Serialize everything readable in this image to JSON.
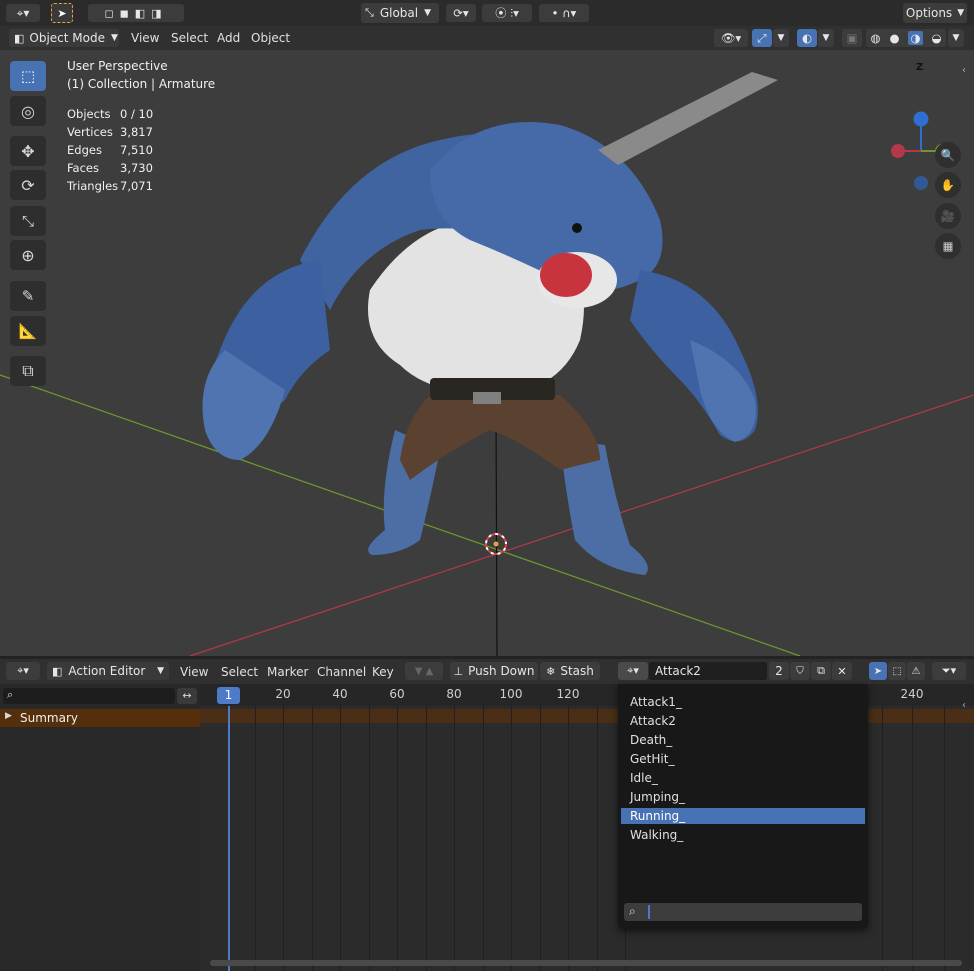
{
  "top_header": {
    "transform_orientation": "Global",
    "options_label": "Options"
  },
  "view_header": {
    "mode": "Object Mode",
    "menus": [
      "View",
      "Select",
      "Add",
      "Object"
    ]
  },
  "viewport": {
    "perspective": "User Perspective",
    "collection": "(1) Collection | Armature",
    "stats": [
      {
        "label": "Objects",
        "value": "0 / 10"
      },
      {
        "label": "Vertices",
        "value": "3,817"
      },
      {
        "label": "Edges",
        "value": "7,510"
      },
      {
        "label": "Faces",
        "value": "3,730"
      },
      {
        "label": "Triangles",
        "value": "7,071"
      }
    ],
    "gizmo_z": "Z",
    "tools": [
      "select-box-icon",
      "cursor-icon",
      "move-icon",
      "rotate-icon",
      "scale-icon",
      "transform-icon",
      "annotate-icon",
      "measure-icon",
      "add-cube-icon"
    ],
    "colors": {
      "x_axis": "#b3384a",
      "y_axis": "#6e9a2c",
      "z_axis": "#2f6fd3",
      "accent": "#4772b3"
    }
  },
  "action_editor": {
    "editor_type": "Action Editor",
    "menus": [
      "View",
      "Select",
      "Marker",
      "Channel",
      "Key"
    ],
    "push_down_label": "Push Down",
    "stash_label": "Stash",
    "action_name": "Attack2",
    "users_count": "2",
    "current_frame": "1",
    "frame_labels": [
      "20",
      "40",
      "60",
      "80",
      "100",
      "120",
      "240"
    ],
    "summary_label": "Summary",
    "search_placeholder": ""
  },
  "action_dropdown": {
    "items": [
      "Attack1_",
      "Attack2",
      "Death_",
      "GetHit_",
      "Idle_",
      "Jumping_",
      "Running_",
      "Walking_"
    ],
    "selected": "Running_",
    "search_value": ""
  }
}
